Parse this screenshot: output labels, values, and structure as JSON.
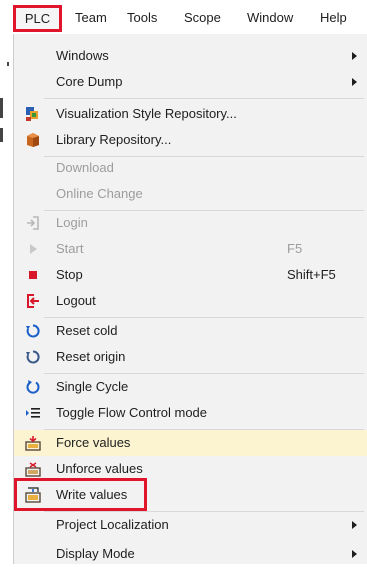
{
  "menubar": {
    "items": [
      "PLC",
      "Team",
      "Tools",
      "Scope",
      "Window",
      "Help"
    ]
  },
  "menu": {
    "items": [
      {
        "label": "Windows",
        "submenu": true
      },
      {
        "label": "Core Dump",
        "submenu": true
      },
      {
        "label": "Visualization Style Repository...",
        "icon": "palette-icon"
      },
      {
        "label": "Library Repository...",
        "icon": "library-icon"
      },
      {
        "label": "Download",
        "disabled": true
      },
      {
        "label": "Online Change",
        "disabled": true
      },
      {
        "label": "Login",
        "icon": "login-icon",
        "disabled": true
      },
      {
        "label": "Start",
        "icon": "play-icon",
        "disabled": true,
        "shortcut": "F5"
      },
      {
        "label": "Stop",
        "icon": "stop-icon",
        "shortcut": "Shift+F5"
      },
      {
        "label": "Logout",
        "icon": "logout-icon"
      },
      {
        "label": "Reset cold",
        "icon": "reset-cold-icon"
      },
      {
        "label": "Reset origin",
        "icon": "reset-origin-icon"
      },
      {
        "label": "Single Cycle",
        "icon": "single-cycle-icon"
      },
      {
        "label": "Toggle Flow Control mode",
        "icon": "flow-control-icon"
      },
      {
        "label": "Force values",
        "icon": "force-values-icon",
        "highlighted": true
      },
      {
        "label": "Unforce values",
        "icon": "unforce-values-icon"
      },
      {
        "label": "Write values",
        "icon": "write-values-icon"
      },
      {
        "label": "Project Localization",
        "submenu": true
      },
      {
        "label": "Display Mode",
        "submenu": true
      }
    ]
  },
  "colors": {
    "highlight": "#e0142a",
    "hover": "#fcf4d0",
    "menu_bg": "#f2f2f2",
    "disabled_text": "#9d9d9d"
  }
}
